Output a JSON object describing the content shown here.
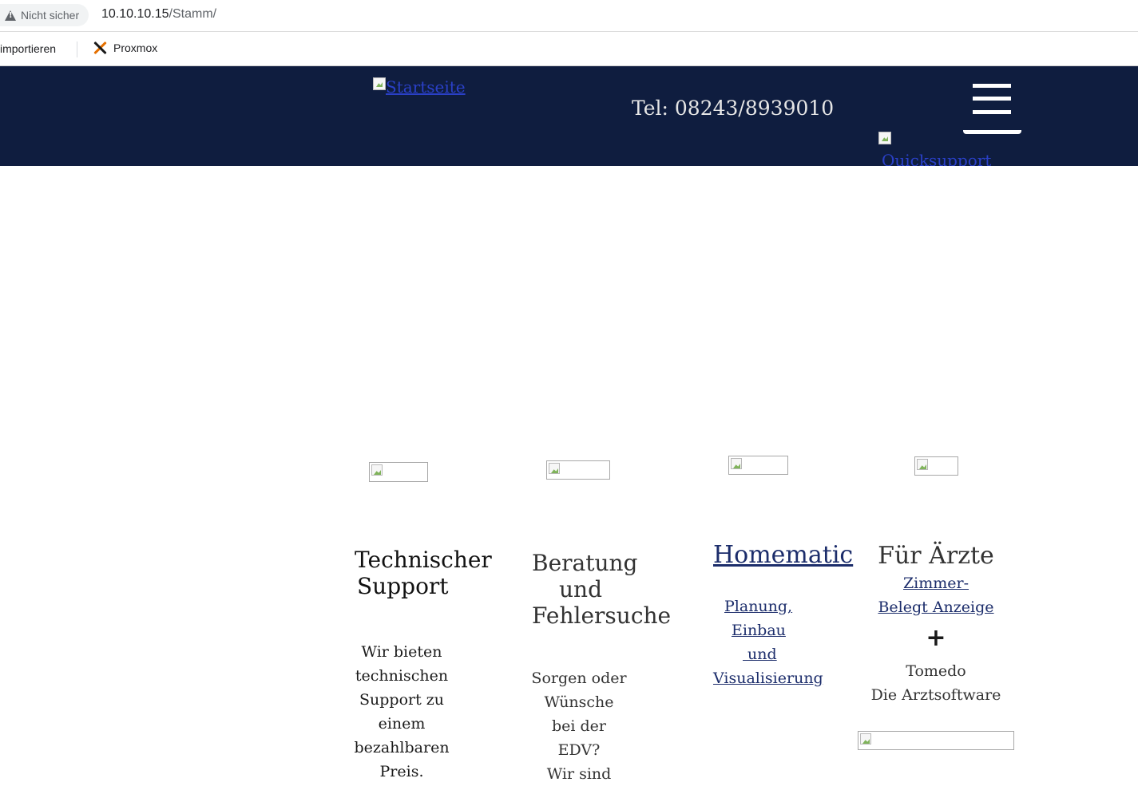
{
  "browser": {
    "security_label": "Nicht sicher",
    "url_host": "10.10.10.15",
    "url_path": "/Stamm/",
    "bookmarks": [
      "importieren",
      "Proxmox"
    ]
  },
  "header": {
    "logo_alt": "Startseite",
    "phone": "Tel: 08243/8939010",
    "quicksupport_alt": "Quicksupport",
    "colors": {
      "background": "#0f1d3f",
      "link": "#2a40c8"
    }
  },
  "columns": {
    "support": {
      "title_line1": "Technischer",
      "title_line2": "Support",
      "text_lines": [
        "Wir bieten",
        "technischen",
        "Support zu",
        "einem",
        "bezahlbaren",
        "Preis."
      ]
    },
    "beratung": {
      "title_line1": "Beratung",
      "title_line2": "und",
      "title_line3": "Fehlersuche",
      "text_lines": [
        "Sorgen oder",
        "Wünsche",
        "bei der",
        "EDV?",
        "Wir sind"
      ]
    },
    "homematic": {
      "title": "Homematic",
      "links": [
        "Planung,",
        "Einbau",
        " und",
        "Visualisierung"
      ]
    },
    "aerzte": {
      "title": "Für Ärzte",
      "link_line1": "Zimmer-",
      "link_line2": "Belegt Anzeige",
      "plus": "+",
      "text_lines": [
        "Tomedo",
        "Die Arztsoftware"
      ]
    }
  }
}
